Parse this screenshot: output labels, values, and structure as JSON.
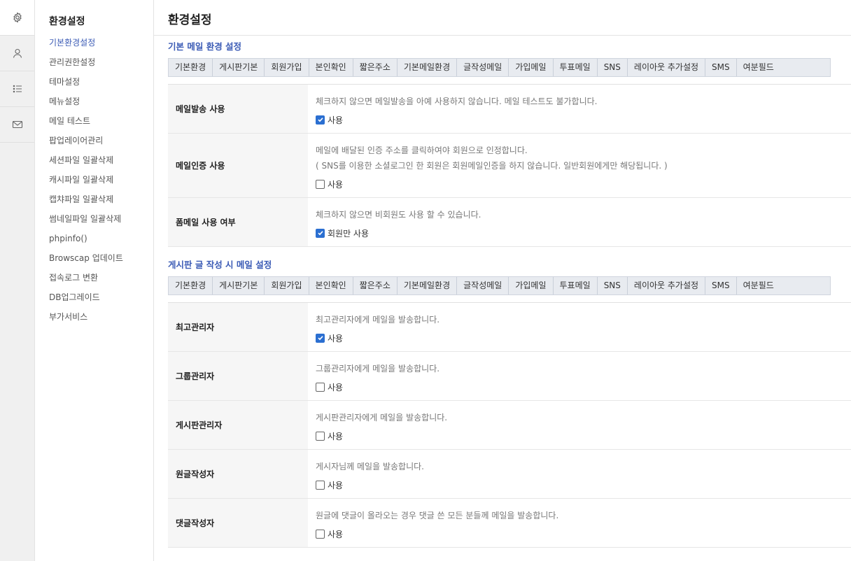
{
  "rail": [
    {
      "icon": "gear-icon",
      "active": true
    },
    {
      "icon": "user-icon",
      "active": false
    },
    {
      "icon": "list-icon",
      "active": false
    },
    {
      "icon": "mail-icon",
      "active": false
    }
  ],
  "menu": {
    "title": "환경설정",
    "items": [
      "기본환경설정",
      "관리권한설정",
      "테마설정",
      "메뉴설정",
      "메일 테스트",
      "팝업레이어관리",
      "세션파일 일괄삭제",
      "캐시파일 일괄삭제",
      "캡챠파일 일괄삭제",
      "썸네일파일 일괄삭제",
      "phpinfo()",
      "Browscap 업데이트",
      "접속로그 변환",
      "DB업그레이드",
      "부가서비스"
    ],
    "active_index": 0
  },
  "page": {
    "title": "환경설정"
  },
  "tabs": [
    "기본환경",
    "게시판기본",
    "회원가입",
    "본인확인",
    "짧은주소",
    "기본메일환경",
    "글작성메일",
    "가입메일",
    "투표메일",
    "SNS",
    "레이아웃 추가설정",
    "SMS",
    "여분필드"
  ],
  "sections": [
    {
      "title": "기본 메일 환경 설정",
      "rows": [
        {
          "label": "메일발송 사용",
          "help": [
            "체크하지 않으면 메일발송을 아예 사용하지 않습니다. 메일 테스트도 불가합니다."
          ],
          "check_label": "사용",
          "checked": true
        },
        {
          "label": "메일인증 사용",
          "help": [
            "메일에 배달된 인증 주소를 클릭하여야 회원으로 인정합니다.",
            "( SNS를 이용한 소셜로그인 한 회원은 회원메일인증을 하지 않습니다. 일반회원에게만 해당됩니다. )"
          ],
          "check_label": "사용",
          "checked": false
        },
        {
          "label": "폼메일 사용 여부",
          "help": [
            "체크하지 않으면 비회원도 사용 할 수 있습니다."
          ],
          "check_label": "회원만 사용",
          "checked": true
        }
      ]
    },
    {
      "title": "게시판 글 작성 시 메일 설정",
      "rows": [
        {
          "label": "최고관리자",
          "help": [
            "최고관리자에게 메일을 발송합니다."
          ],
          "check_label": "사용",
          "checked": true
        },
        {
          "label": "그룹관리자",
          "help": [
            "그룹관리자에게 메일을 발송합니다."
          ],
          "check_label": "사용",
          "checked": false
        },
        {
          "label": "게시판관리자",
          "help": [
            "게시판관리자에게 메일을 발송합니다."
          ],
          "check_label": "사용",
          "checked": false
        },
        {
          "label": "원글작성자",
          "help": [
            "게시자님께 메일을 발송합니다."
          ],
          "check_label": "사용",
          "checked": false
        },
        {
          "label": "댓글작성자",
          "help": [
            "원글에 댓글이 올라오는 경우 댓글 쓴 모든 분들께 메일을 발송합니다."
          ],
          "check_label": "사용",
          "checked": false
        }
      ]
    }
  ],
  "colors": {
    "accent": "#3b5bb5",
    "checkbox": "#2b6fd1"
  }
}
